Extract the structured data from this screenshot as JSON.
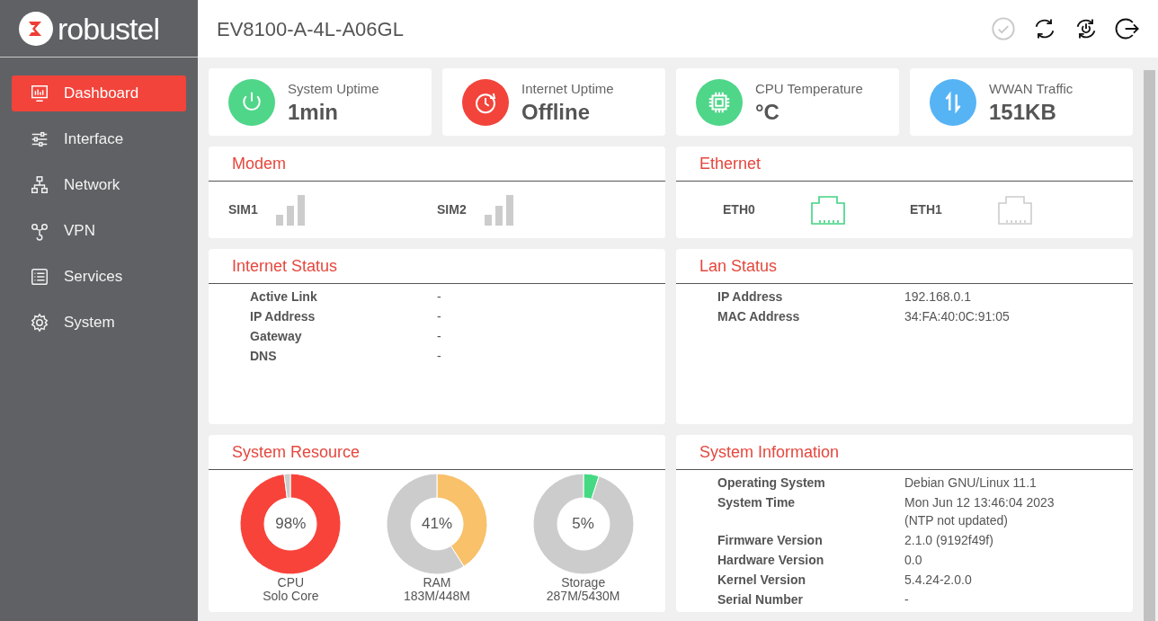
{
  "logo_text": "robustel",
  "device_title": "EV8100-A-4L-A06GL",
  "header_actions": [
    {
      "disabled": true
    },
    {
      "disabled": false
    },
    {
      "disabled": false
    },
    {
      "disabled": false
    }
  ],
  "sidebar": {
    "items": [
      {
        "label": "Dashboard",
        "selected": true
      },
      {
        "label": "Interface",
        "selected": false
      },
      {
        "label": "Network",
        "selected": false
      },
      {
        "label": "VPN",
        "selected": false
      },
      {
        "label": "Services",
        "selected": false
      },
      {
        "label": "System",
        "selected": false
      }
    ]
  },
  "stat_cards": [
    {
      "label": "System Uptime",
      "value": "1min",
      "color": "#4fd689"
    },
    {
      "label": "Internet Uptime",
      "value": "Offline",
      "color": "#f2443b"
    },
    {
      "label": "CPU Temperature",
      "value": "°C",
      "color": "#4fd689"
    },
    {
      "label": "WWAN Traffic",
      "value": "151KB",
      "color": "#56b4f5"
    }
  ],
  "modem": {
    "title": "Modem",
    "sims": [
      {
        "label": "SIM1"
      },
      {
        "label": "SIM2"
      }
    ]
  },
  "ethernet": {
    "title": "Ethernet",
    "ports": [
      {
        "label": "ETH0",
        "connected": true
      },
      {
        "label": "ETH1",
        "connected": false
      }
    ]
  },
  "internet_status": {
    "title": "Internet Status",
    "rows": [
      {
        "key": "Active Link",
        "value": "-"
      },
      {
        "key": "IP Address",
        "value": "-"
      },
      {
        "key": "Gateway",
        "value": "-"
      },
      {
        "key": "DNS",
        "value": "-"
      }
    ]
  },
  "lan_status": {
    "title": "Lan Status",
    "rows": [
      {
        "key": "IP Address",
        "value": "192.168.0.1"
      },
      {
        "key": "MAC Address",
        "value": "34:FA:40:0C:91:05"
      }
    ]
  },
  "system_resource": {
    "title": "System Resource",
    "gauges": [
      {
        "reading": "98%",
        "name": "CPU",
        "detail": "Solo Core",
        "color": "#f8433a",
        "chart_data": {
          "type": "donut",
          "values": [
            98,
            2
          ]
        }
      },
      {
        "reading": "41%",
        "name": "RAM",
        "detail": "183M/448M",
        "color": "#f8c16a",
        "chart_data": {
          "type": "donut",
          "values": [
            41,
            59
          ]
        }
      },
      {
        "reading": "5%",
        "name": "Storage",
        "detail": "287M/5430M",
        "color": "#45d983",
        "chart_data": {
          "type": "donut",
          "values": [
            5,
            95
          ]
        }
      }
    ]
  },
  "system_information": {
    "title": "System Information",
    "rows": [
      {
        "key": "Operating System",
        "value": "Debian GNU/Linux 11.1"
      },
      {
        "key": "System Time",
        "value": "Mon Jun 12 13:46:04 2023 (NTP not updated)"
      },
      {
        "key": "Firmware Version",
        "value": "2.1.0 (9192f49f)"
      },
      {
        "key": "Hardware Version",
        "value": "0.0"
      },
      {
        "key": "Kernel Version",
        "value": "5.4.24-2.0.0"
      },
      {
        "key": "Serial Number",
        "value": "-"
      }
    ]
  }
}
